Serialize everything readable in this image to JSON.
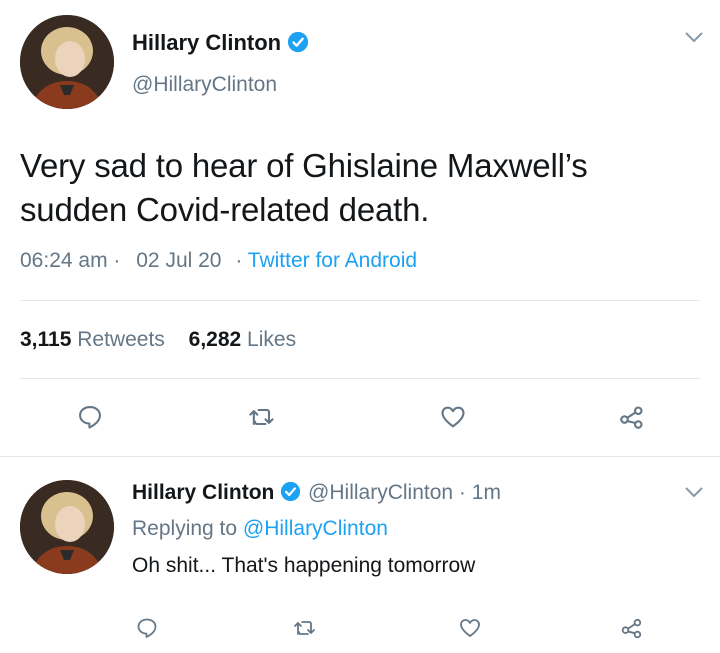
{
  "tweet": {
    "author_name": "Hillary Clinton",
    "author_handle": "@HillaryClinton",
    "text_line1": "Very sad to hear of Ghislaine Maxwell’s",
    "text_line2": "sudden Covid-related death.",
    "time": "06:24 am",
    "date_sep": "·",
    "date": "02 Jul 20",
    "source_sep": "·",
    "source": "Twitter for Android",
    "retweets_count": "3,115",
    "retweets_label": "Retweets",
    "likes_count": "6,282",
    "likes_label": "Likes"
  },
  "reply": {
    "author_name": "Hillary Clinton",
    "author_handle": "@HillaryClinton",
    "time_sep": "·",
    "time": "1m",
    "replying_prefix": "Replying to",
    "replying_handle": "@HillaryClinton",
    "text": "Oh shit... That's happening tomorrow"
  },
  "colors": {
    "accent": "#1da1f2",
    "muted": "#657786",
    "text": "#14171a",
    "divider": "#e1e8ed"
  },
  "icons": {
    "verified": "verified-badge-icon",
    "menu": "chevron-down-icon",
    "reply": "reply-icon",
    "retweet": "retweet-icon",
    "like": "heart-icon",
    "share": "share-icon"
  }
}
